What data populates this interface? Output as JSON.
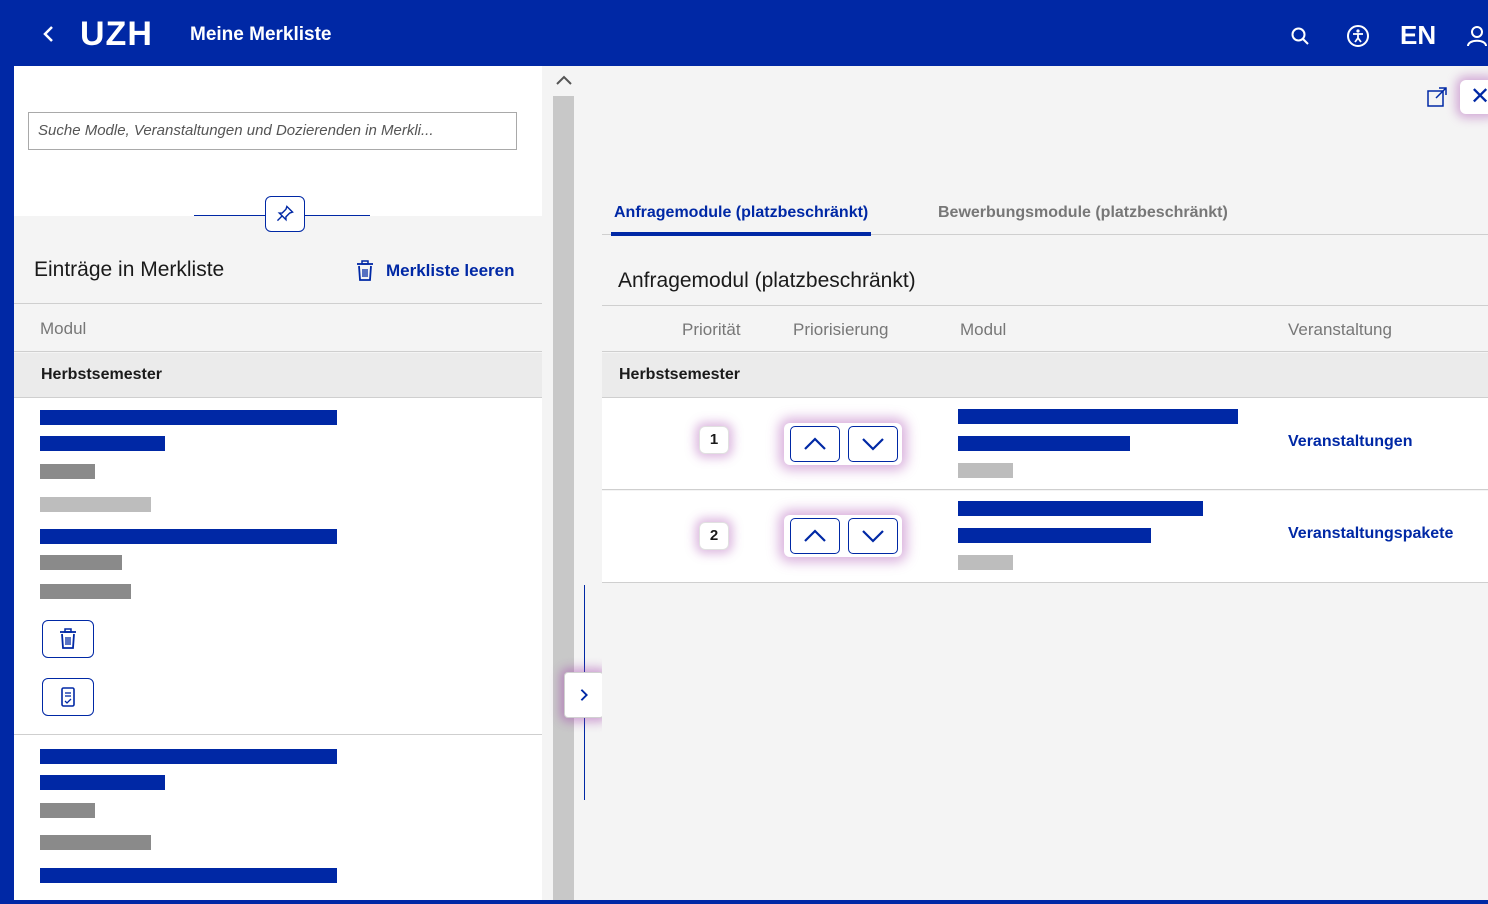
{
  "header": {
    "back_label": "<",
    "logo": "UZH",
    "title": "Meine Merkliste",
    "lang": "EN"
  },
  "sidebar": {
    "search_placeholder": "Suche Modle, Veranstaltungen und Dozierenden in Merkli...",
    "list_title": "Einträge in Merkliste",
    "clear_label": "Merkliste leeren",
    "column_header": "Modul",
    "semester_label": "Herbstsemester"
  },
  "main": {
    "tabs": [
      {
        "label": "Anfragemodule (platzbeschränkt)",
        "active": true
      },
      {
        "label": "Bewerbungsmodule (platzbeschränkt)",
        "active": false
      }
    ],
    "section_title": "Anfragemodul (platzbeschränkt)",
    "columns": [
      "Priorität",
      "Priorisierung",
      "Modul",
      "Veranstaltung"
    ],
    "semester_label": "Herbstsemester",
    "rows": [
      {
        "priority": "1",
        "veranstaltung": "Veranstaltungen"
      },
      {
        "priority": "2",
        "veranstaltung": "Veranstaltungspakete"
      }
    ]
  },
  "colors": {
    "brand_blue": "#0028a5",
    "panel_grey": "#f4f4f4",
    "highlight_glow": "#a03caa"
  },
  "icons": [
    "back-chevron-icon",
    "search-icon",
    "accessibility-icon",
    "user-icon",
    "pin-icon",
    "trash-icon",
    "checklist-icon",
    "scroll-up-icon",
    "chevron-right-icon",
    "external-link-icon",
    "close-icon",
    "chevron-up-icon",
    "chevron-down-icon"
  ]
}
